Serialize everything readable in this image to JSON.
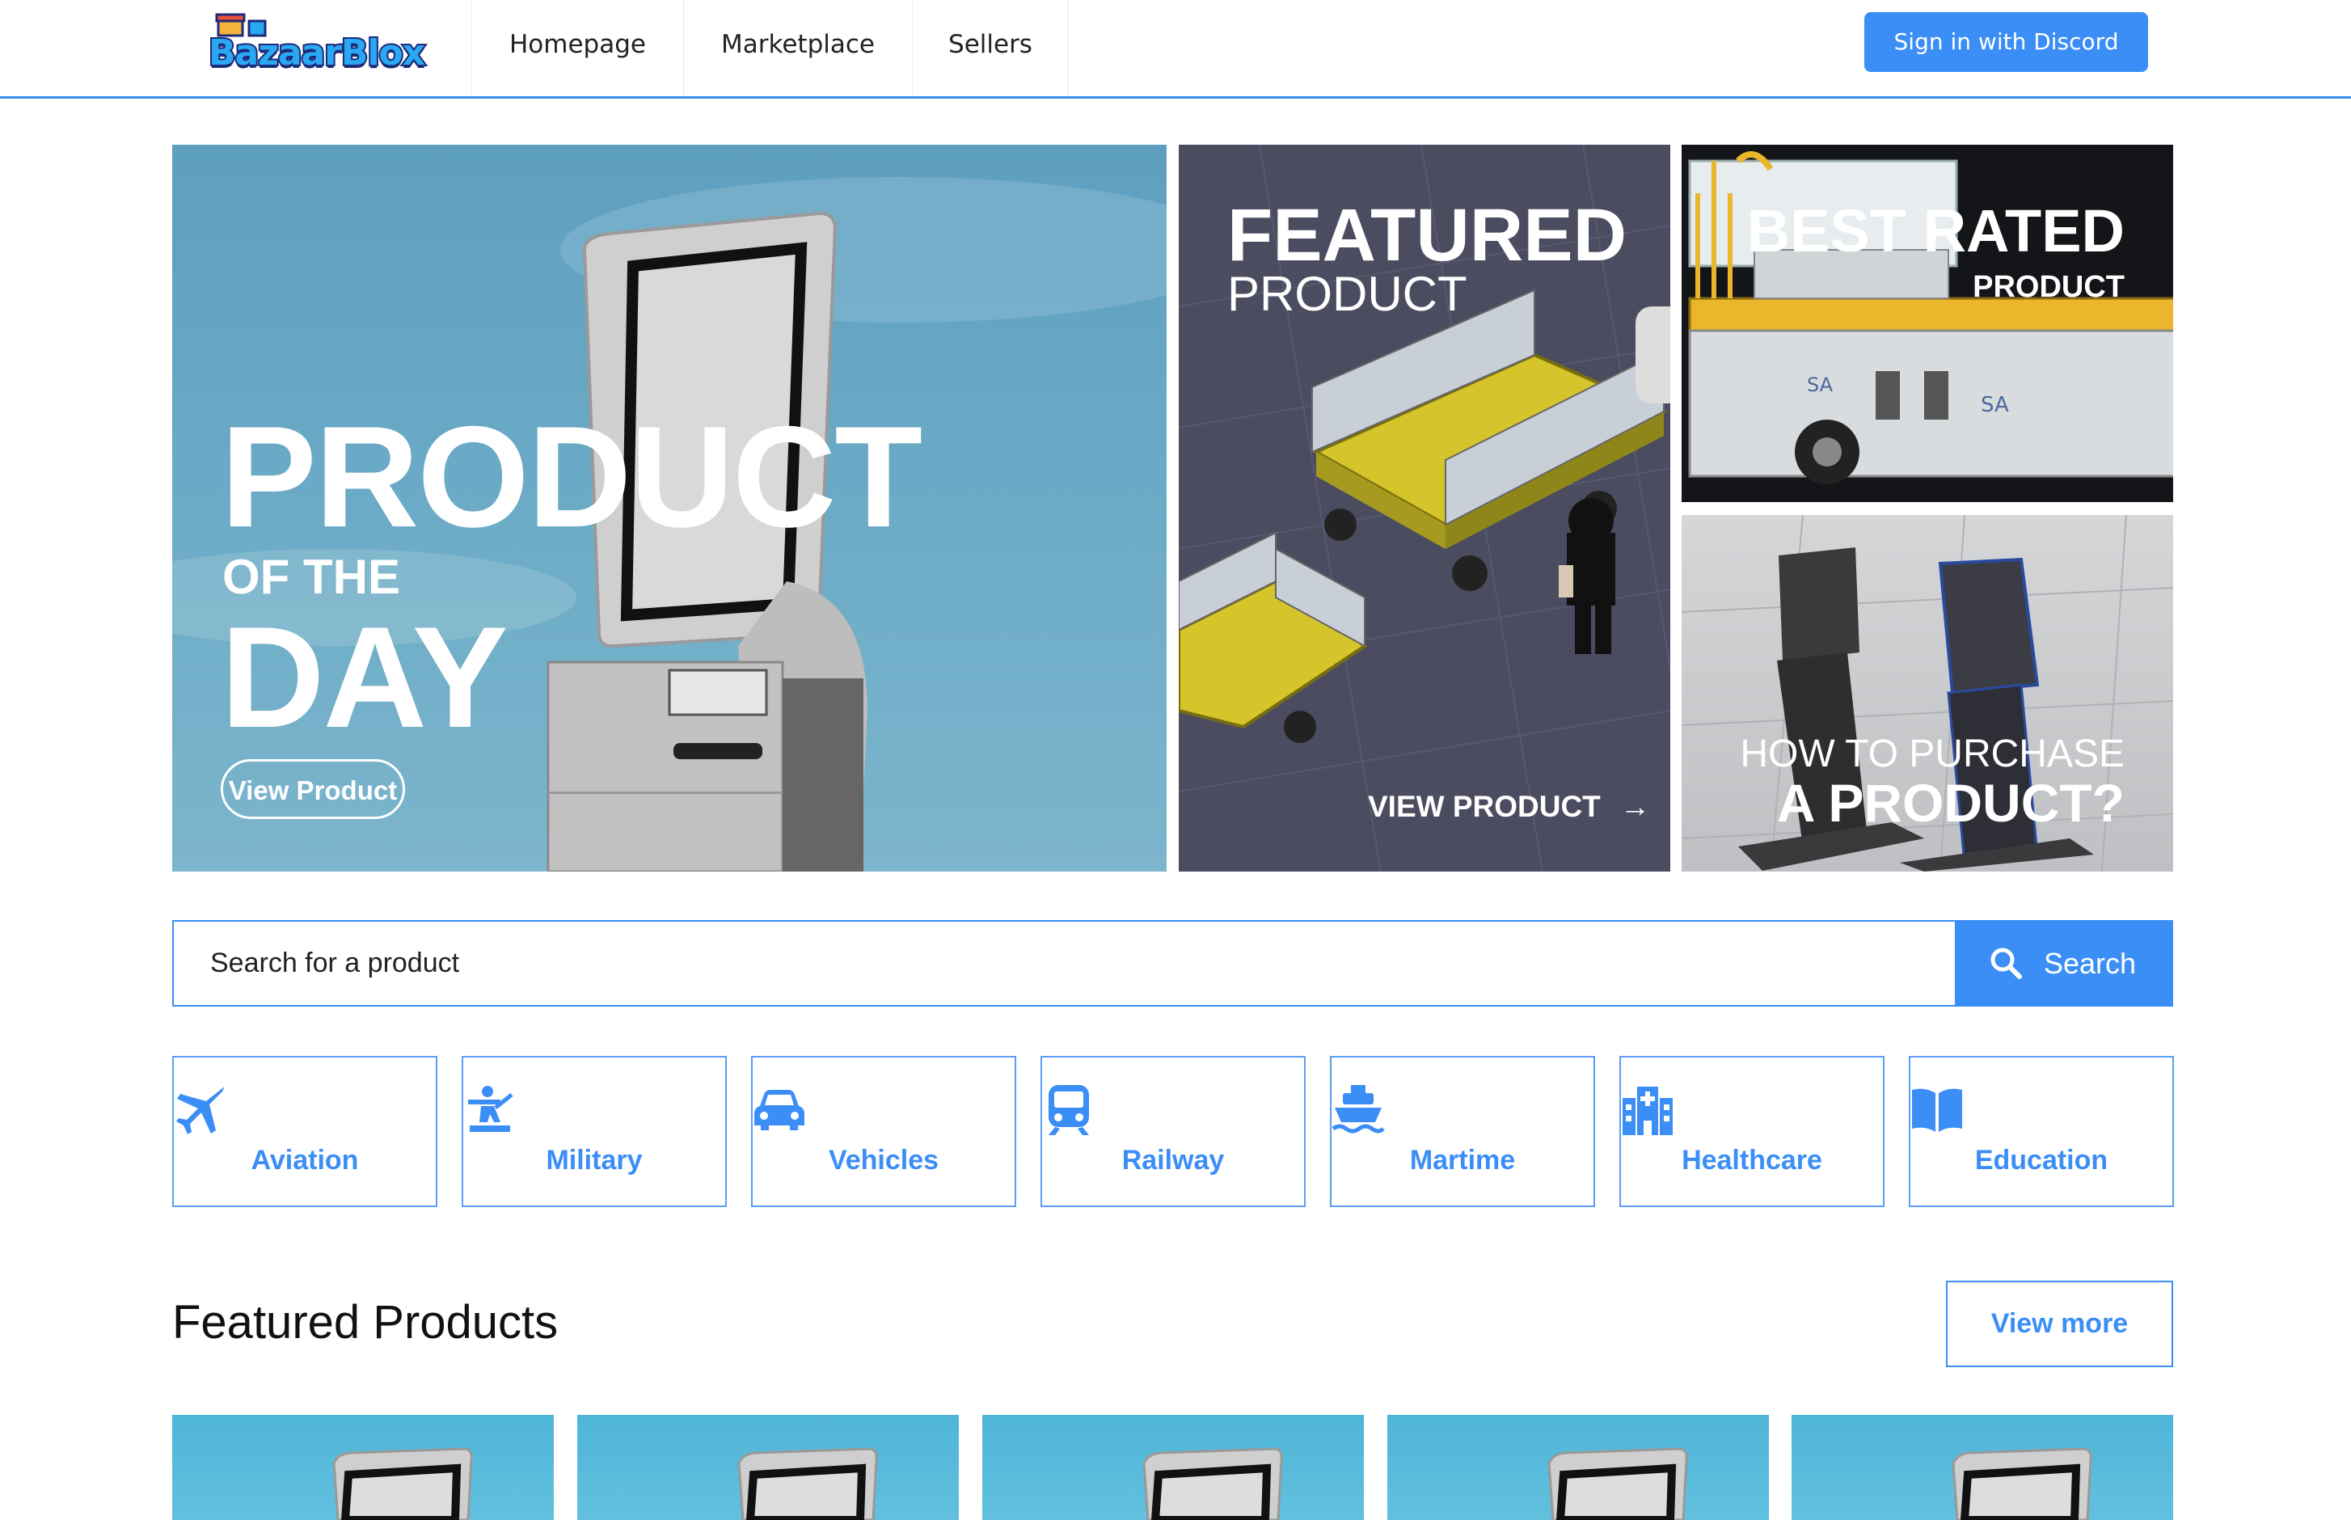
{
  "brand": {
    "name": "BazaarBlox"
  },
  "nav": {
    "items": [
      {
        "label": "Homepage"
      },
      {
        "label": "Marketplace"
      },
      {
        "label": "Sellers"
      }
    ],
    "signin_label": "Sign in with Discord"
  },
  "hero": {
    "pod": {
      "line1": "PRODUCT",
      "line2": "OF THE",
      "line3": "DAY",
      "button": "View Product"
    },
    "featured": {
      "line1": "FEATURED",
      "line2": "PRODUCT",
      "link": "VIEW PRODUCT"
    },
    "best": {
      "line1": "BEST RATED",
      "line2": "PRODUCT"
    },
    "how": {
      "line1": "HOW TO PURCHASE",
      "line2": "A PRODUCT?"
    }
  },
  "search": {
    "placeholder": "Search for a product",
    "button": "Search"
  },
  "categories": [
    {
      "label": "Aviation",
      "icon": "plane-icon"
    },
    {
      "label": "Military",
      "icon": "person-rifle-icon"
    },
    {
      "label": "Vehicles",
      "icon": "car-icon"
    },
    {
      "label": "Railway",
      "icon": "train-icon"
    },
    {
      "label": "Martime",
      "icon": "ship-icon"
    },
    {
      "label": "Healthcare",
      "icon": "hospital-icon"
    },
    {
      "label": "Education",
      "icon": "book-open-icon"
    }
  ],
  "featured_section": {
    "title": "Featured Products",
    "view_more": "View more"
  },
  "colors": {
    "accent": "#3a8ef6",
    "text": "#111111",
    "white": "#ffffff"
  }
}
